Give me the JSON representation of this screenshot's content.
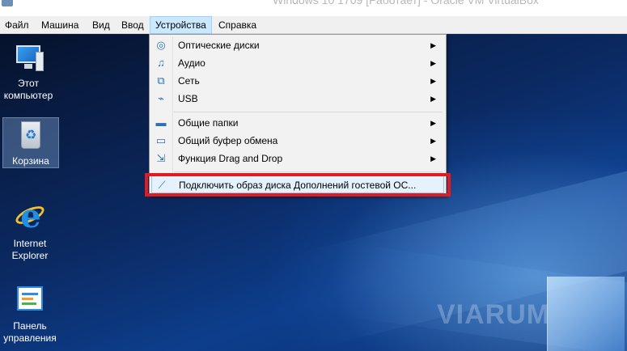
{
  "window": {
    "title": "Windows 10 1709 [Работает] - Oracle VM VirtualBox"
  },
  "menubar": {
    "items": [
      "Файл",
      "Машина",
      "Вид",
      "Ввод",
      "Устройства",
      "Справка"
    ],
    "active": "Устройства"
  },
  "devices_menu": {
    "items": [
      {
        "label": "Оптические диски",
        "icon": "optical-disc-icon",
        "submenu": true
      },
      {
        "label": "Аудио",
        "icon": "audio-icon",
        "submenu": true
      },
      {
        "label": "Сеть",
        "icon": "network-icon",
        "submenu": true
      },
      {
        "label": "USB",
        "icon": "usb-icon",
        "submenu": true
      },
      {
        "label": "Общие папки",
        "icon": "shared-folder-icon",
        "submenu": true
      },
      {
        "label": "Общий буфер обмена",
        "icon": "clipboard-icon",
        "submenu": true
      },
      {
        "label": "Функция Drag and Drop",
        "icon": "drag-drop-icon",
        "submenu": true
      },
      {
        "label": "Подключить образ диска Дополнений гостевой ОС...",
        "icon": "insert-guest-additions-icon",
        "submenu": false,
        "highlighted": true
      }
    ],
    "submenu_arrow": "▶"
  },
  "desktop": {
    "icons": [
      {
        "label": "Этот компьютер",
        "icon": "this-pc-icon"
      },
      {
        "label": "Корзина",
        "icon": "recycle-bin-icon",
        "selected": true
      },
      {
        "label": "Internet Explorer",
        "icon": "internet-explorer-icon"
      },
      {
        "label": "Панель управления",
        "icon": "control-panel-icon"
      }
    ],
    "watermark": "VIARUM"
  },
  "highlight_color": "#e11b22"
}
